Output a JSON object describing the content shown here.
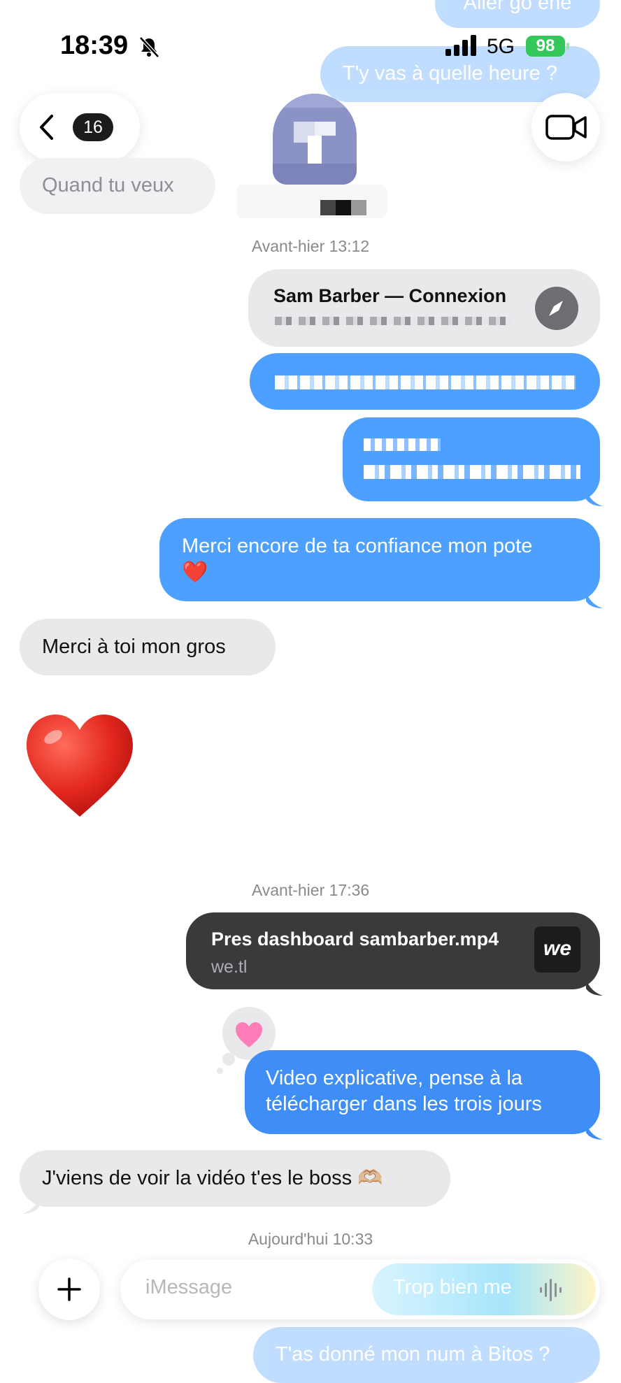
{
  "status_bar": {
    "time": "18:39",
    "network": "5G",
    "battery": "98"
  },
  "header": {
    "back_count": "16"
  },
  "top_faded_messages": [
    "Aller go ene",
    "T'y vas à quelle heure ?",
    "Quand tu veux"
  ],
  "timestamps": [
    "Avant-hier 13:12",
    "Avant-hier 17:36",
    "Aujourd'hui 10:33"
  ],
  "link_preview_1": {
    "title": "Sam Barber — Connexion"
  },
  "messages": {
    "merci_confiance": "Merci encore de ta confiance mon pote",
    "merci_toi": "Merci à toi mon gros",
    "video_1": "Video explicative, pense à la",
    "video_2": "télécharger dans les trois jours",
    "jviens": "J'viens de voir la vidéo t'es le boss 🫶🏼"
  },
  "link_preview_2": {
    "title": "Pres dashboard sambarber.mp4",
    "domain": "we.tl",
    "logo": "we"
  },
  "composer": {
    "placeholder": "iMessage",
    "draft_faded": "Trop bien me"
  },
  "bottom_faded_message": "T'as donné mon num à Bitos ?",
  "colors": {
    "blue": "#4da0ff",
    "grey": "#e9e9eb",
    "dark_preview": "#3a3a3c",
    "battery_green": "#34c759"
  }
}
